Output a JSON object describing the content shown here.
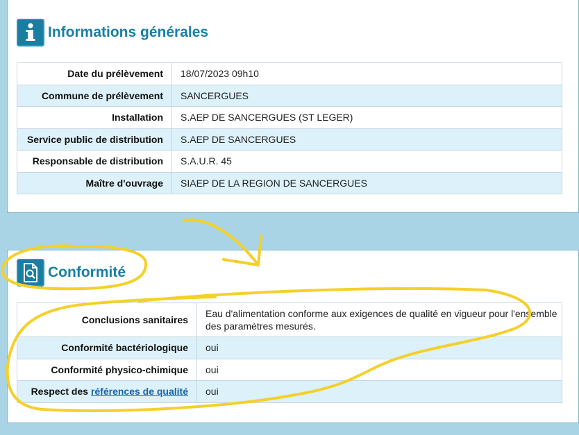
{
  "info": {
    "title": "Informations générales",
    "icon": "info-icon",
    "rows": [
      {
        "label": "Date du prélèvement",
        "value": "18/07/2023  09h10"
      },
      {
        "label": "Commune de prélèvement",
        "value": "SANCERGUES"
      },
      {
        "label": "Installation",
        "value": "S.AEP DE SANCERGUES (ST LEGER)"
      },
      {
        "label": "Service public de distribution",
        "value": "S.AEP DE SANCERGUES"
      },
      {
        "label": "Responsable de distribution",
        "value": "S.A.U.R. 45"
      },
      {
        "label": "Maître d'ouvrage",
        "value": "SIAEP DE LA REGION DE SANCERGUES"
      }
    ]
  },
  "conformite": {
    "title": "Conformité",
    "icon": "document-search-icon",
    "rows": [
      {
        "label": "Conclusions sanitaires",
        "value": "Eau d'alimentation conforme aux exigences de qualité en vigueur pour l'ensemble des paramètres mesurés."
      },
      {
        "label": "Conformité bactériologique",
        "value": "oui"
      },
      {
        "label": "Conformité physico-chimique",
        "value": "oui"
      },
      {
        "label_prefix": "Respect des ",
        "label_link": "références de qualité",
        "value": "oui"
      }
    ]
  },
  "colors": {
    "background": "#a8d4e6",
    "accent": "#1a7ea3",
    "row_alt": "#dcf1f9",
    "annotation": "#f5d02a",
    "link": "#1565b0"
  }
}
